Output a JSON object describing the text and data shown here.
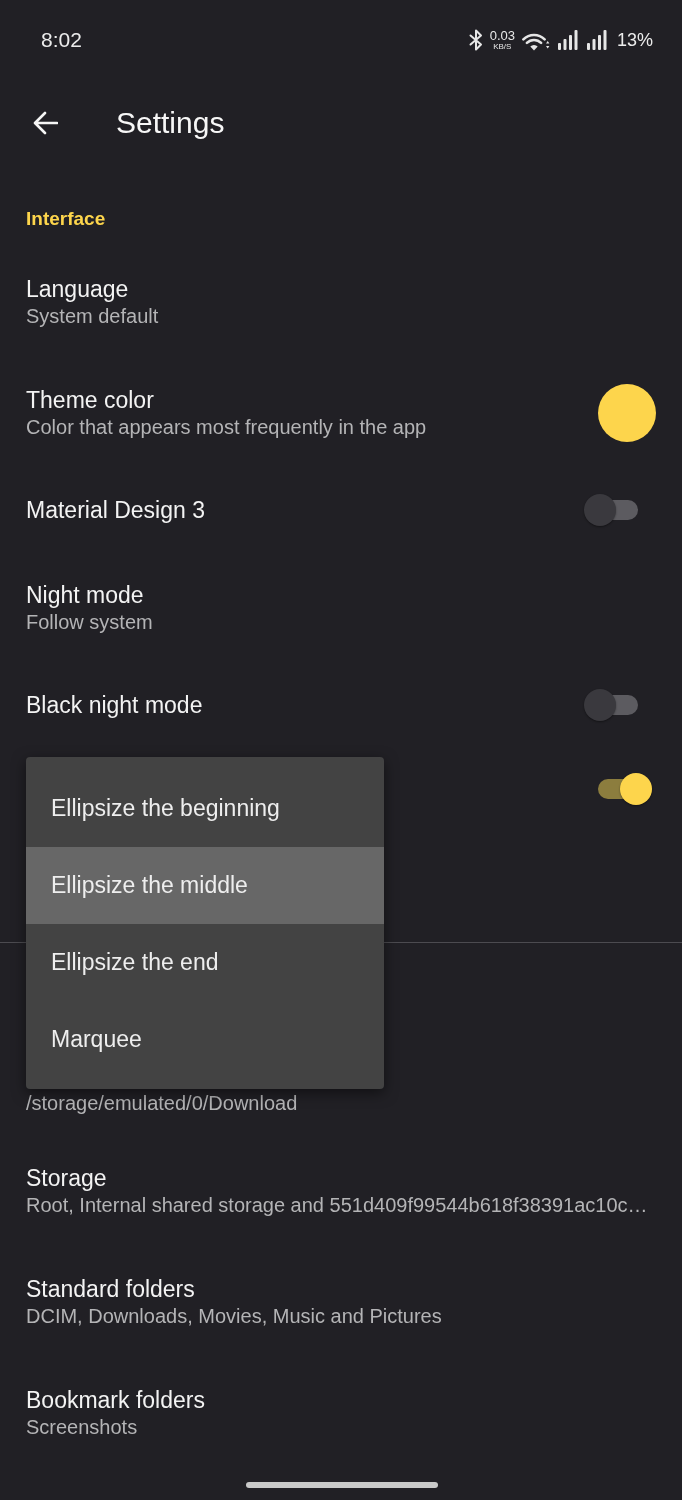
{
  "status_bar": {
    "time": "8:02",
    "net_speed": "0.03",
    "net_speed_unit": "KB/S",
    "battery": "13%"
  },
  "toolbar": {
    "title": "Settings"
  },
  "sections": [
    {
      "header": "Interface",
      "items": [
        {
          "kind": "text",
          "title": "Language",
          "summary": "System default"
        },
        {
          "kind": "color",
          "title": "Theme color",
          "summary": "Color that appears most frequently in the app",
          "color": "#fdd54c"
        },
        {
          "kind": "switch",
          "title": "Material Design 3",
          "on": false
        },
        {
          "kind": "text",
          "title": "Night mode",
          "summary": "Follow system"
        },
        {
          "kind": "switch",
          "title": "Black night mode",
          "on": false
        },
        {
          "kind": "switch",
          "on": true
        }
      ]
    },
    {
      "items": [
        {
          "kind": "text",
          "summary": "/storage/emulated/0/Download"
        },
        {
          "kind": "text",
          "title": "Storage",
          "summary": "Root, Internal shared storage and 551d409f99544b618f38391ac10c…"
        },
        {
          "kind": "text",
          "title": "Standard folders",
          "summary": "DCIM, Downloads, Movies, Music and Pictures"
        },
        {
          "kind": "text",
          "title": "Bookmark folders",
          "summary": "Screenshots"
        }
      ]
    }
  ],
  "popup_menu": {
    "items": [
      {
        "label": "Ellipsize the beginning",
        "selected": false
      },
      {
        "label": "Ellipsize the middle",
        "selected": true
      },
      {
        "label": "Ellipsize the end",
        "selected": false
      },
      {
        "label": "Marquee",
        "selected": false
      }
    ]
  }
}
